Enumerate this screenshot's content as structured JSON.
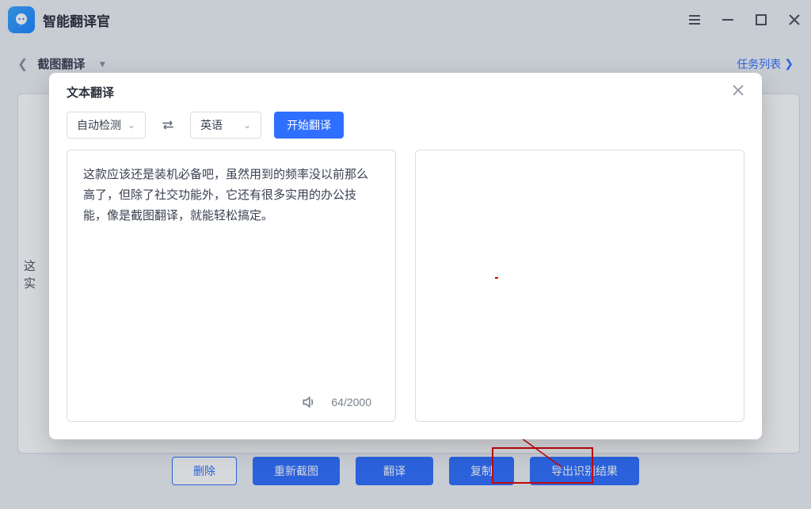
{
  "app": {
    "title": "智能翻译官"
  },
  "breadcrumb": {
    "title": "截图翻译",
    "task_link": "任务列表"
  },
  "background": {
    "snippet_line1": "这",
    "snippet_line2": "实"
  },
  "bottom_bar": {
    "delete": "删除",
    "rescreenshot": "重新截图",
    "translate": "翻译",
    "copy": "复制",
    "export": "导出识别结果"
  },
  "modal": {
    "title": "文本翻译",
    "source_lang": "自动检测",
    "target_lang": "英语",
    "start": "开始翻译",
    "input_text": "这款应该还是装机必备吧，虽然用到的频率没以前那么高了，但除了社交功能外，它还有很多实用的办公技能，像是截图翻译，就能轻松搞定。",
    "counter": "64/2000"
  }
}
